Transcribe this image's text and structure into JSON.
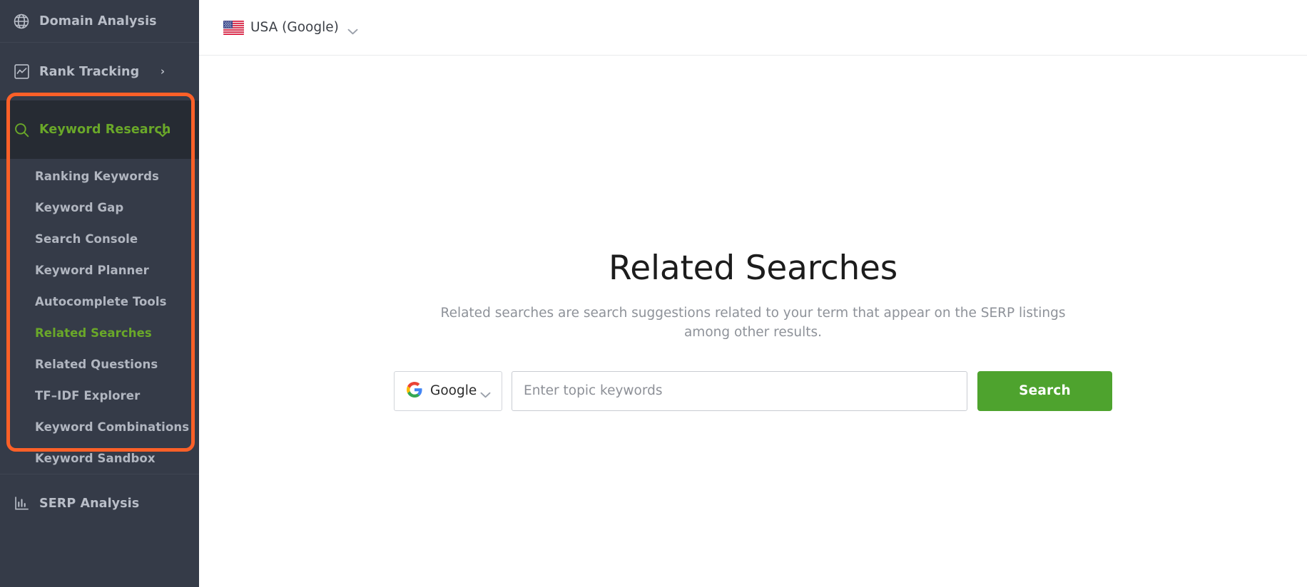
{
  "sidebar": {
    "top_item": {
      "label": "Domain Analysis",
      "icon": "globe-icon"
    },
    "rank_tracking": {
      "label": "Rank Tracking",
      "icon": "chart-line-icon",
      "chevron": "›"
    },
    "keyword_research": {
      "label": "Keyword Research",
      "icon": "search-icon",
      "state": "expanded",
      "active": true
    },
    "submenu": [
      {
        "label": "Ranking Keywords",
        "selected": false
      },
      {
        "label": "Keyword Gap",
        "selected": false
      },
      {
        "label": "Search Console",
        "selected": false
      },
      {
        "label": "Keyword Planner",
        "selected": false
      },
      {
        "label": "Autocomplete Tools",
        "selected": false
      },
      {
        "label": "Related Searches",
        "selected": true
      },
      {
        "label": "Related Questions",
        "selected": false
      },
      {
        "label": "TF–IDF Explorer",
        "selected": false
      },
      {
        "label": "Keyword Combinations",
        "selected": false
      },
      {
        "label": "Keyword Sandbox",
        "selected": false
      }
    ],
    "serp_analysis": {
      "label": "SERP Analysis",
      "icon": "bar-chart-icon"
    }
  },
  "topbar": {
    "country": "USA (Google)",
    "flag_icon": "usa-flag-icon",
    "caret_icon": "chevron-down-icon"
  },
  "main": {
    "title": "Related Searches",
    "subtitle": "Related searches are search suggestions related to your term that appear on the SERP listings among other results.",
    "engine": {
      "selected": "Google",
      "icon": "google-logo-icon",
      "caret_icon": "chevron-down-icon"
    },
    "keyword_input": {
      "value": "",
      "placeholder": "Enter topic keywords"
    },
    "search_button": "Search"
  },
  "colors": {
    "sidebar_bg": "#353b48",
    "sidebar_active_bg": "#262b33",
    "accent_green": "#6aa829",
    "button_green": "#4ea32e",
    "highlight_orange": "#fc6028",
    "text_muted": "#8e9299"
  }
}
